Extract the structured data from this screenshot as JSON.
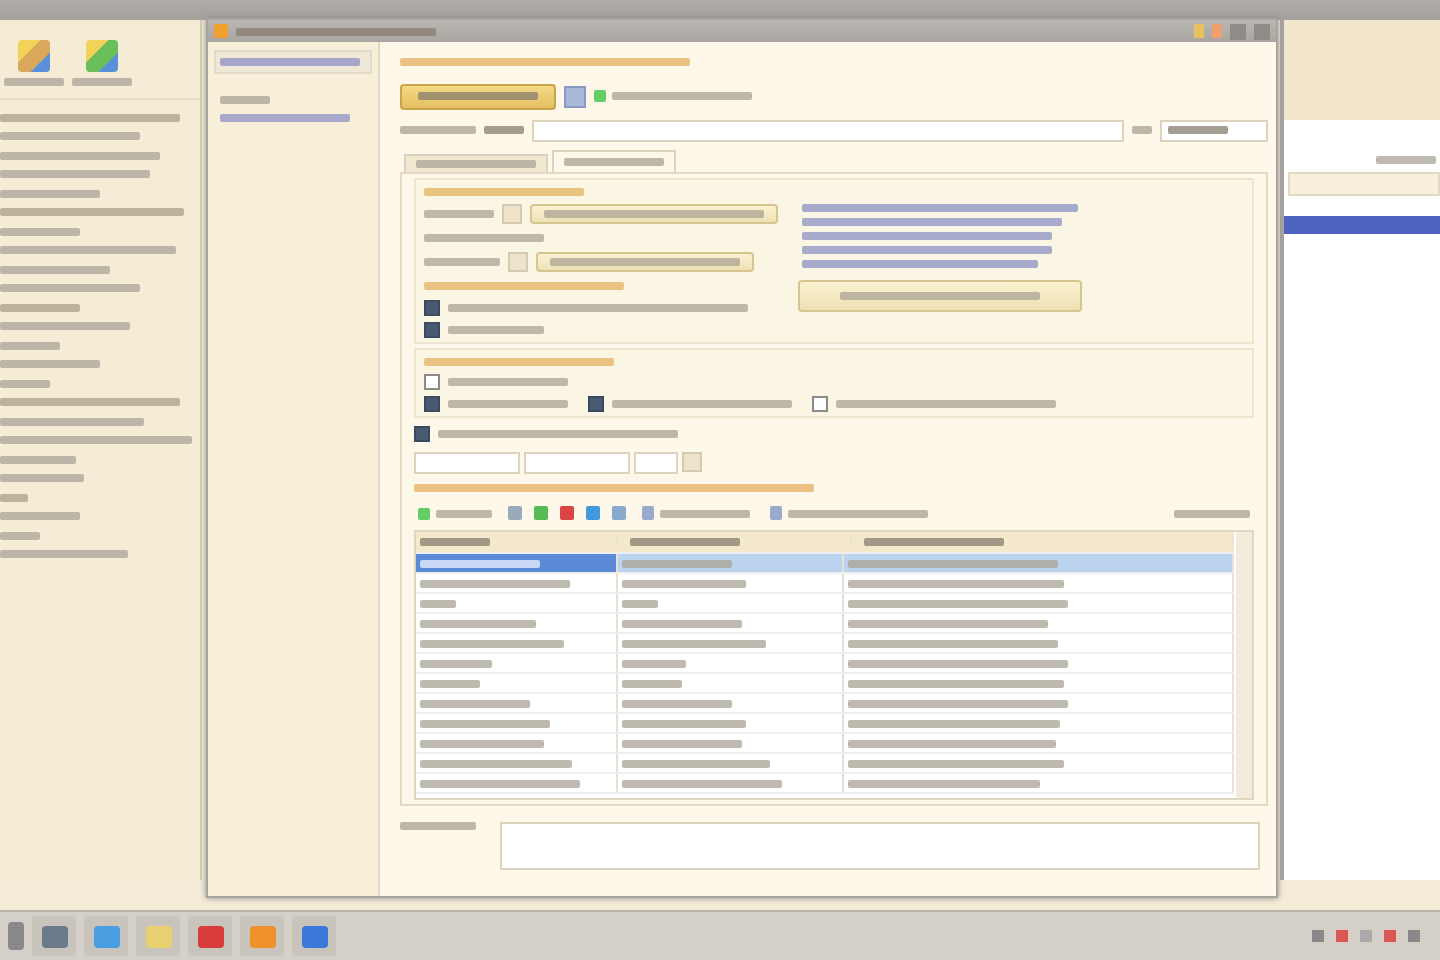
{
  "tabs": [
    {
      "selected": false
    },
    {
      "selected": true
    }
  ],
  "options": [
    {
      "checked": true
    },
    {
      "checked": true
    },
    {
      "checked": false
    },
    {
      "checked": true
    },
    {
      "checked": true
    },
    {
      "checked": false
    },
    {
      "checked": true
    }
  ],
  "table": {
    "rows": [
      {
        "selected": true
      },
      {
        "selected": false
      },
      {
        "selected": false
      },
      {
        "selected": false
      },
      {
        "selected": false
      },
      {
        "selected": false
      },
      {
        "selected": false
      },
      {
        "selected": false
      },
      {
        "selected": false
      },
      {
        "selected": false
      },
      {
        "selected": false
      },
      {
        "selected": false
      }
    ]
  }
}
